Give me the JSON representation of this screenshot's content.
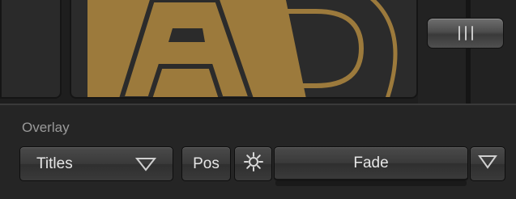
{
  "overlay": {
    "label": "Overlay",
    "source_select": {
      "value": "Titles"
    },
    "position_button": {
      "label": "Pos"
    },
    "settings_button": {
      "icon": "gear-icon"
    },
    "transition_button": {
      "label": "Fade"
    },
    "transition_dropdown": {
      "icon": "chevron-down-icon"
    }
  },
  "preview": {
    "graphic_letters": [
      "A",
      "D"
    ],
    "graphic_color": "#9c7a3c"
  },
  "colors": {
    "background": "#222222",
    "label_text": "#9a9a9a",
    "button_text": "#e6e6e6",
    "accent_gold": "#9c7a3c"
  }
}
